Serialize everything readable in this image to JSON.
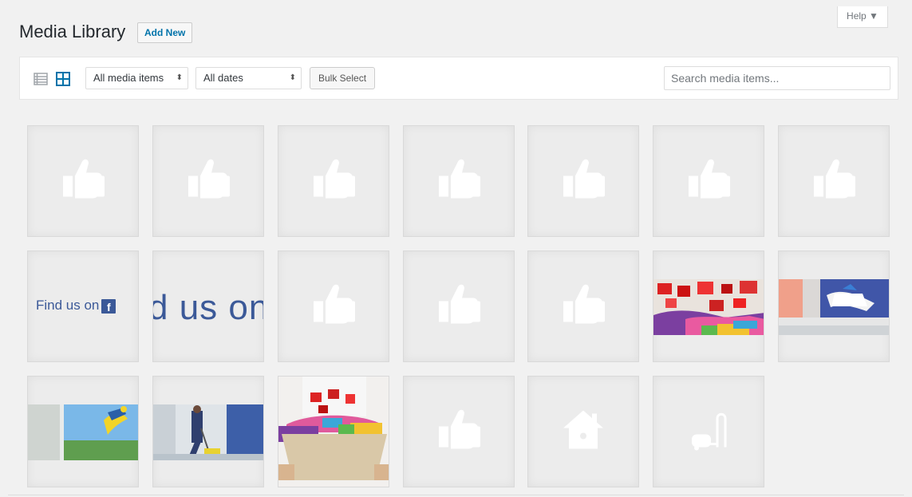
{
  "header": {
    "title": "Media Library",
    "add_new_label": "Add New",
    "help_label": "Help ▼"
  },
  "toolbar": {
    "list_view_icon": "list-view-icon",
    "grid_view_icon": "grid-view-icon",
    "type_filter": {
      "selected": "All media items",
      "arrow": "⬍"
    },
    "date_filter": {
      "selected": "All dates",
      "arrow": "⬍"
    },
    "bulk_select_label": "Bulk Select",
    "search_placeholder": "Search media items..."
  },
  "media_items": [
    {
      "kind": "placeholder",
      "icon": "thumbs-up-icon"
    },
    {
      "kind": "placeholder",
      "icon": "thumbs-up-icon"
    },
    {
      "kind": "placeholder",
      "icon": "thumbs-up-icon"
    },
    {
      "kind": "placeholder",
      "icon": "thumbs-up-icon"
    },
    {
      "kind": "placeholder",
      "icon": "thumbs-up-icon"
    },
    {
      "kind": "placeholder",
      "icon": "thumbs-up-icon"
    },
    {
      "kind": "placeholder",
      "icon": "thumbs-up-icon"
    },
    {
      "kind": "facebook-badge",
      "text": "Find us on",
      "badge": "f"
    },
    {
      "kind": "facebook-banner-crop",
      "text": "d us on"
    },
    {
      "kind": "placeholder",
      "icon": "thumbs-up-icon"
    },
    {
      "kind": "placeholder",
      "icon": "thumbs-up-icon"
    },
    {
      "kind": "placeholder",
      "icon": "thumbs-up-icon"
    },
    {
      "kind": "photo",
      "subject": "laundry-quilt-photo"
    },
    {
      "kind": "photo",
      "subject": "ironing-photo"
    },
    {
      "kind": "photo",
      "subject": "window-cleaning-photo"
    },
    {
      "kind": "photo",
      "subject": "floor-cleaning-photo"
    },
    {
      "kind": "photo",
      "subject": "laundry-basket-photo"
    },
    {
      "kind": "placeholder",
      "icon": "thumbs-up-icon"
    },
    {
      "kind": "placeholder",
      "icon": "house-icon"
    },
    {
      "kind": "placeholder",
      "icon": "vacuum-icon"
    }
  ],
  "colors": {
    "accent": "#0073aa",
    "facebook": "#3b5998",
    "tile_bg": "#ececec",
    "page_bg": "#f1f1f1"
  }
}
